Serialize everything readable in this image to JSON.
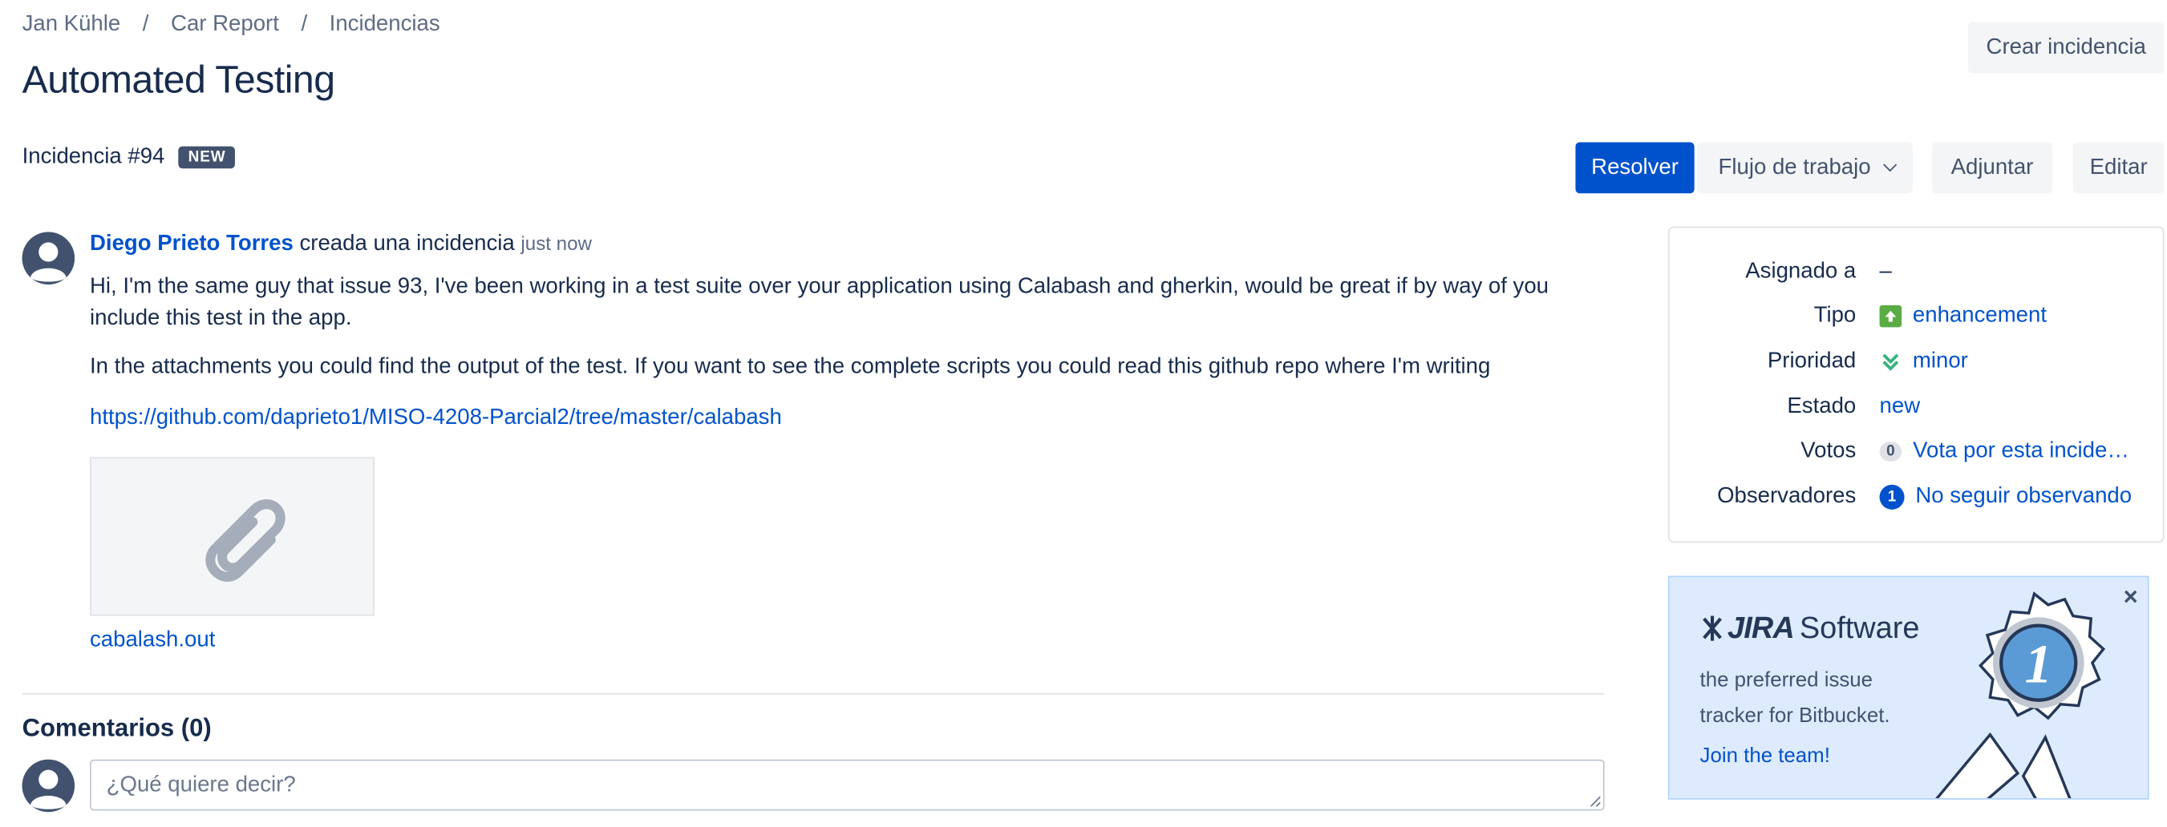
{
  "breadcrumb": {
    "items": [
      "Jan Kühle",
      "Car Report",
      "Incidencias"
    ],
    "separator": "/"
  },
  "page": {
    "title": "Automated Testing"
  },
  "header": {
    "create_label": "Crear incidencia"
  },
  "issue": {
    "id_label": "Incidencia #94",
    "status_badge": "NEW",
    "actions": {
      "resolve": "Resolver",
      "workflow": "Flujo de trabajo",
      "attach": "Adjuntar",
      "edit": "Editar"
    },
    "author": "Diego Prieto Torres",
    "action_text": "creada una incidencia",
    "timestamp": "just now",
    "description_1": "Hi, I'm the same guy that issue 93, I've been working in a test suite over your application using Calabash and gherkin, would be great if by way of you include this test in the app.",
    "description_2": "In the attachments you could find the output of the test. If you want to see the complete scripts you could read this github repo where I'm writing",
    "repo_link": "https://github.com/daprieto1/MISO-4208-Parcial2/tree/master/calabash",
    "attachment_name": "cabalash.out"
  },
  "comments": {
    "title": "Comentarios (0)",
    "placeholder": "¿Qué quiere decir?"
  },
  "details": {
    "assignee_label": "Asignado a",
    "assignee_value": "–",
    "type_label": "Tipo",
    "type_value": "enhancement",
    "priority_label": "Prioridad",
    "priority_value": "minor",
    "status_label": "Estado",
    "status_value": "new",
    "votes_label": "Votos",
    "votes_count": "0",
    "votes_link": "Vota por esta incidencia",
    "watchers_label": "Observadores",
    "watchers_count": "1",
    "watchers_link": "No seguir observando"
  },
  "promo": {
    "brand": "JIRA",
    "brand_suffix": "Software",
    "text": "the preferred issue tracker for Bitbucket.",
    "cta": "Join the team!",
    "ribbon_number": "1",
    "close": "×"
  },
  "colors": {
    "primary": "#0052cc",
    "text": "#172b4d",
    "muted": "#5e6c84",
    "enhancement": "#5aac44",
    "promo_bg": "#deebff"
  }
}
